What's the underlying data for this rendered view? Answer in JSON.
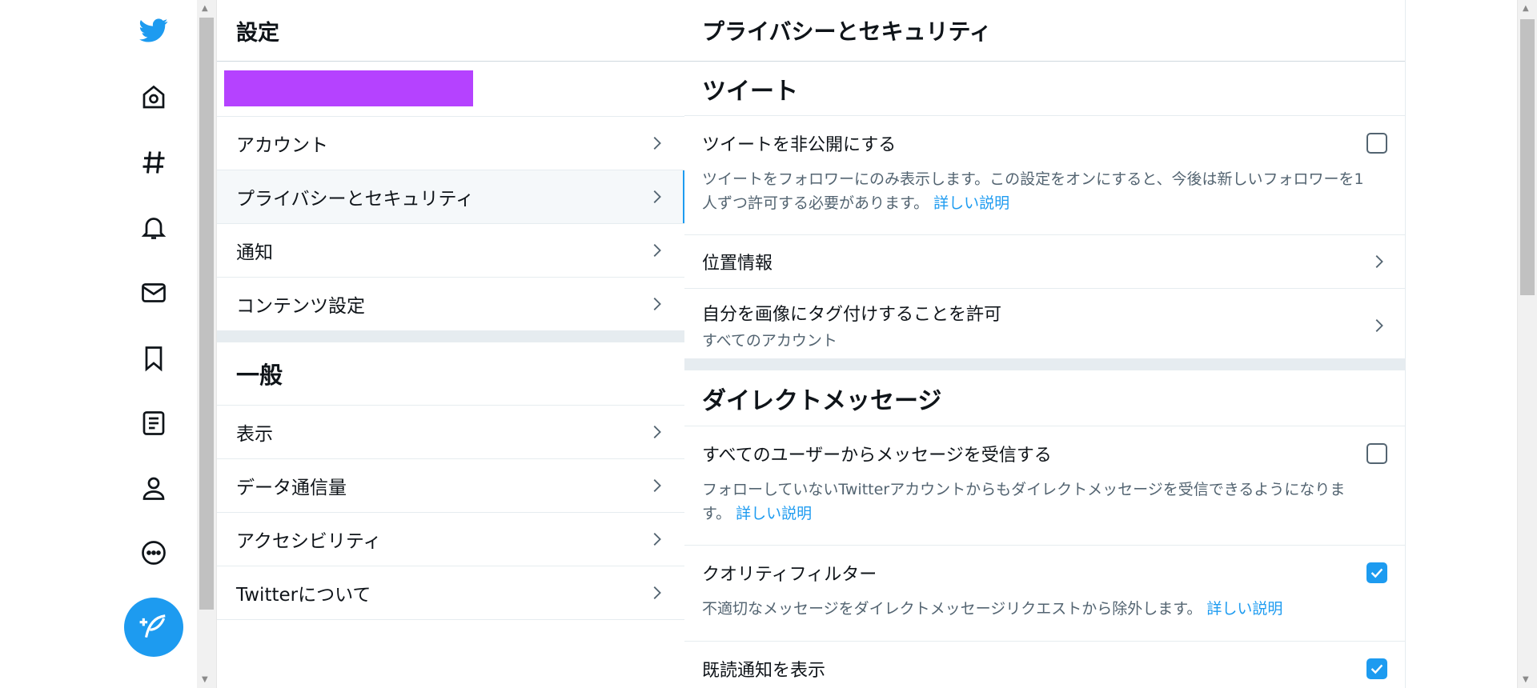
{
  "nav": {
    "icons": [
      "twitter-logo-icon",
      "home-icon",
      "hashtag-icon",
      "bell-icon",
      "mail-icon",
      "bookmark-icon",
      "list-icon",
      "profile-icon",
      "more-icon"
    ],
    "compose_icon": "compose-tweet-icon",
    "accent": "#1d9bf0"
  },
  "settings": {
    "title": "設定",
    "items": [
      {
        "label": "アカウント"
      },
      {
        "label": "プライバシーとセキュリティ"
      },
      {
        "label": "通知"
      },
      {
        "label": "コンテンツ設定"
      }
    ],
    "general_title": "一般",
    "general_items": [
      {
        "label": "表示"
      },
      {
        "label": "データ通信量"
      },
      {
        "label": "アクセシビリティ"
      },
      {
        "label": "Twitterについて"
      }
    ]
  },
  "detail": {
    "title": "プライバシーとセキュリティ",
    "tweets_section": "ツイート",
    "protect": {
      "title": "ツイートを非公開にする",
      "desc": "ツイートをフォロワーにのみ表示します。この設定をオンにすると、今後は新しいフォロワーを1人ずつ許可する必要があります。",
      "link": "詳しい説明",
      "checked": false
    },
    "location": {
      "title": "位置情報"
    },
    "photo_tag": {
      "title": "自分を画像にタグ付けすることを許可",
      "sub": "すべてのアカウント"
    },
    "dm_section": "ダイレクトメッセージ",
    "dm_all": {
      "title": "すべてのユーザーからメッセージを受信する",
      "desc": "フォローしていないTwitterアカウントからもダイレクトメッセージを受信できるようになります。",
      "link": "詳しい説明",
      "checked": false
    },
    "quality": {
      "title": "クオリティフィルター",
      "desc": "不適切なメッセージをダイレクトメッセージリクエストから除外します。",
      "link": "詳しい説明",
      "checked": true
    },
    "read_receipts": {
      "title": "既読通知を表示",
      "checked": true
    }
  }
}
